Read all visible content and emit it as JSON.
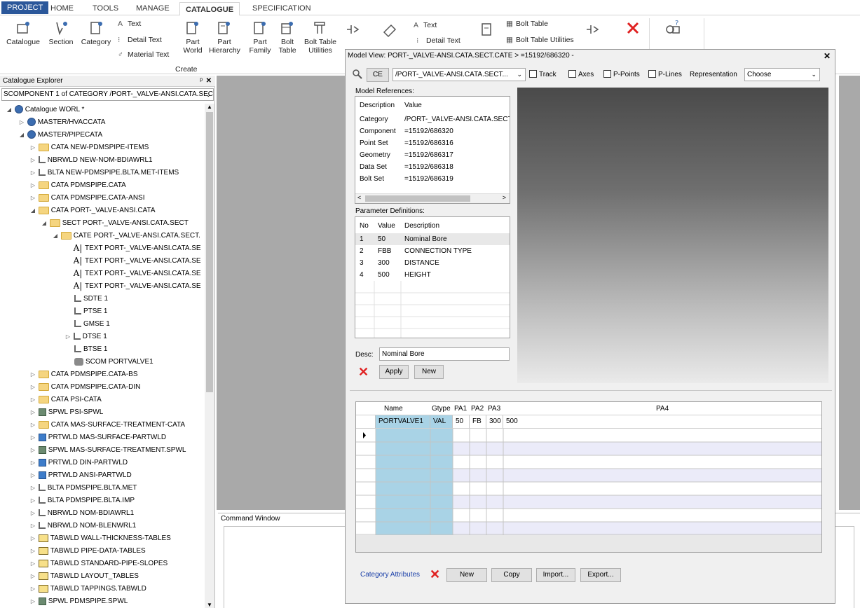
{
  "ribbon": {
    "tabs": [
      "PROJECT",
      "HOME",
      "TOOLS",
      "MANAGE",
      "CATALOGUE",
      "SPECIFICATION"
    ],
    "active_tab": "CATALOGUE",
    "buttons": {
      "catalogue": "Catalogue",
      "section": "Section",
      "category": "Category",
      "text": "Text",
      "detail_text": "Detail Text",
      "material_text": "Material Text",
      "part_world_1": "Part",
      "part_world_2": "World",
      "part_hierarchy_1": "Part",
      "part_hierarchy_2": "Hierarchy",
      "part_family_1": "Part",
      "part_family_2": "Family",
      "bolt_table_1": "Bolt",
      "bolt_table_2": "Table",
      "bolt_table_util_1": "Bolt Table",
      "bolt_table_util_2": "Utilities",
      "text2": "Text",
      "detail_text2": "Detail Text",
      "bolt_table3": "Bolt Table",
      "bolt_table_utilities3": "Bolt Table Utilities"
    },
    "group_create": "Create"
  },
  "explorer": {
    "title": "Catalogue Explorer",
    "combo_value": "SCOMPONENT 1 of CATEGORY /PORT-_VALVE-ANSI.CATA.SEC",
    "nodes": [
      {
        "label": "Catalogue WORL *"
      },
      {
        "label": "MASTER/HVACCATA"
      },
      {
        "label": "MASTER/PIPECATA"
      },
      {
        "label": "CATA NEW-PDMSPIPE-ITEMS"
      },
      {
        "label": "NBRWLD NEW-NOM-BDIAWRL1"
      },
      {
        "label": "BLTA NEW-PDMSPIPE.BLTA.MET-ITEMS"
      },
      {
        "label": "CATA PDMSPIPE.CATA"
      },
      {
        "label": "CATA PDMSPIPE.CATA-ANSI"
      },
      {
        "label": "CATA PORT-_VALVE-ANSI.CATA"
      },
      {
        "label": "SECT PORT-_VALVE-ANSI.CATA.SECT"
      },
      {
        "label": "CATE PORT-_VALVE-ANSI.CATA.SECT."
      },
      {
        "label": "TEXT PORT-_VALVE-ANSI.CATA.SE"
      },
      {
        "label": "TEXT PORT-_VALVE-ANSI.CATA.SE"
      },
      {
        "label": "TEXT PORT-_VALVE-ANSI.CATA.SE"
      },
      {
        "label": "TEXT PORT-_VALVE-ANSI.CATA.SE"
      },
      {
        "label": "SDTE 1"
      },
      {
        "label": "PTSE 1"
      },
      {
        "label": "GMSE 1"
      },
      {
        "label": "DTSE 1"
      },
      {
        "label": "BTSE 1"
      },
      {
        "label": "SCOM PORTVALVE1"
      },
      {
        "label": "CATA PDMSPIPE.CATA-BS"
      },
      {
        "label": "CATA PDMSPIPE.CATA-DIN"
      },
      {
        "label": "CATA PSI-CATA"
      },
      {
        "label": "SPWL PSI-SPWL"
      },
      {
        "label": "CATA MAS-SURFACE-TREATMENT-CATA"
      },
      {
        "label": "PRTWLD MAS-SURFACE-PARTWLD"
      },
      {
        "label": "SPWL MAS-SURFACE-TREATMENT.SPWL"
      },
      {
        "label": "PRTWLD DIN-PARTWLD"
      },
      {
        "label": "PRTWLD ANSI-PARTWLD"
      },
      {
        "label": "BLTA PDMSPIPE.BLTA.MET"
      },
      {
        "label": "BLTA PDMSPIPE.BLTA.IMP"
      },
      {
        "label": "NBRWLD NOM-BDIAWRL1"
      },
      {
        "label": "NBRWLD NOM-BLENWRL1"
      },
      {
        "label": "TABWLD WALL-THICKNESS-TABLES"
      },
      {
        "label": "TABWLD PIPE-DATA-TABLES"
      },
      {
        "label": "TABWLD STANDARD-PIPE-SLOPES"
      },
      {
        "label": "TABWLD LAYOUT_TABLES"
      },
      {
        "label": "TABWLD TAPPINGS.TABWLD"
      },
      {
        "label": "SPWL PDMSPIPE.SPWL"
      }
    ]
  },
  "command_window": {
    "title": "Command Window"
  },
  "dialog": {
    "title": "Model View: PORT-_VALVE-ANSI.CATA.SECT.CATE > =15192/686320 -",
    "ce_button": "CE",
    "element_combo": "/PORT-_VALVE-ANSI.CATA.SECT...",
    "track": "Track",
    "axes": "Axes",
    "ppoints": "P-Points",
    "plines": "P-Lines",
    "representation_label": "Representation",
    "representation_value": "Choose",
    "model_refs": {
      "title": "Model References:",
      "col_description": "Description",
      "col_value": "Value",
      "rows": [
        {
          "d": "Category",
          "v": "/PORT-_VALVE-ANSI.CATA.SECT"
        },
        {
          "d": "Component",
          "v": "=15192/686320"
        },
        {
          "d": "Point Set",
          "v": "=15192/686316"
        },
        {
          "d": "Geometry",
          "v": "=15192/686317"
        },
        {
          "d": "Data Set",
          "v": "=15192/686318"
        },
        {
          "d": "Bolt Set",
          "v": "=15192/686319"
        }
      ]
    },
    "param_defs": {
      "title": "Parameter Definitions:",
      "col_no": "No",
      "col_value": "Value",
      "col_description": "Description",
      "rows": [
        {
          "no": "1",
          "value": "50",
          "desc": "Nominal Bore"
        },
        {
          "no": "2",
          "value": "FBB",
          "desc": "CONNECTION TYPE"
        },
        {
          "no": "3",
          "value": "300",
          "desc": "DISTANCE"
        },
        {
          "no": "4",
          "value": "500",
          "desc": "HEIGHT"
        }
      ]
    },
    "desc_label": "Desc:",
    "desc_value": "Nominal Bore",
    "apply": "Apply",
    "new": "New",
    "grid": {
      "headers": [
        "Name",
        "Gtype",
        "PA1",
        "PA2",
        "PA3",
        "PA4"
      ],
      "row": {
        "name": "PORTVALVE1",
        "gtype": "VAL",
        "pa1": "50",
        "pa2": "FB",
        "pa3": "300",
        "pa4": "500"
      }
    },
    "category_attributes": "Category Attributes",
    "btn_new": "New",
    "btn_copy": "Copy",
    "btn_import": "Import...",
    "btn_export": "Export..."
  }
}
